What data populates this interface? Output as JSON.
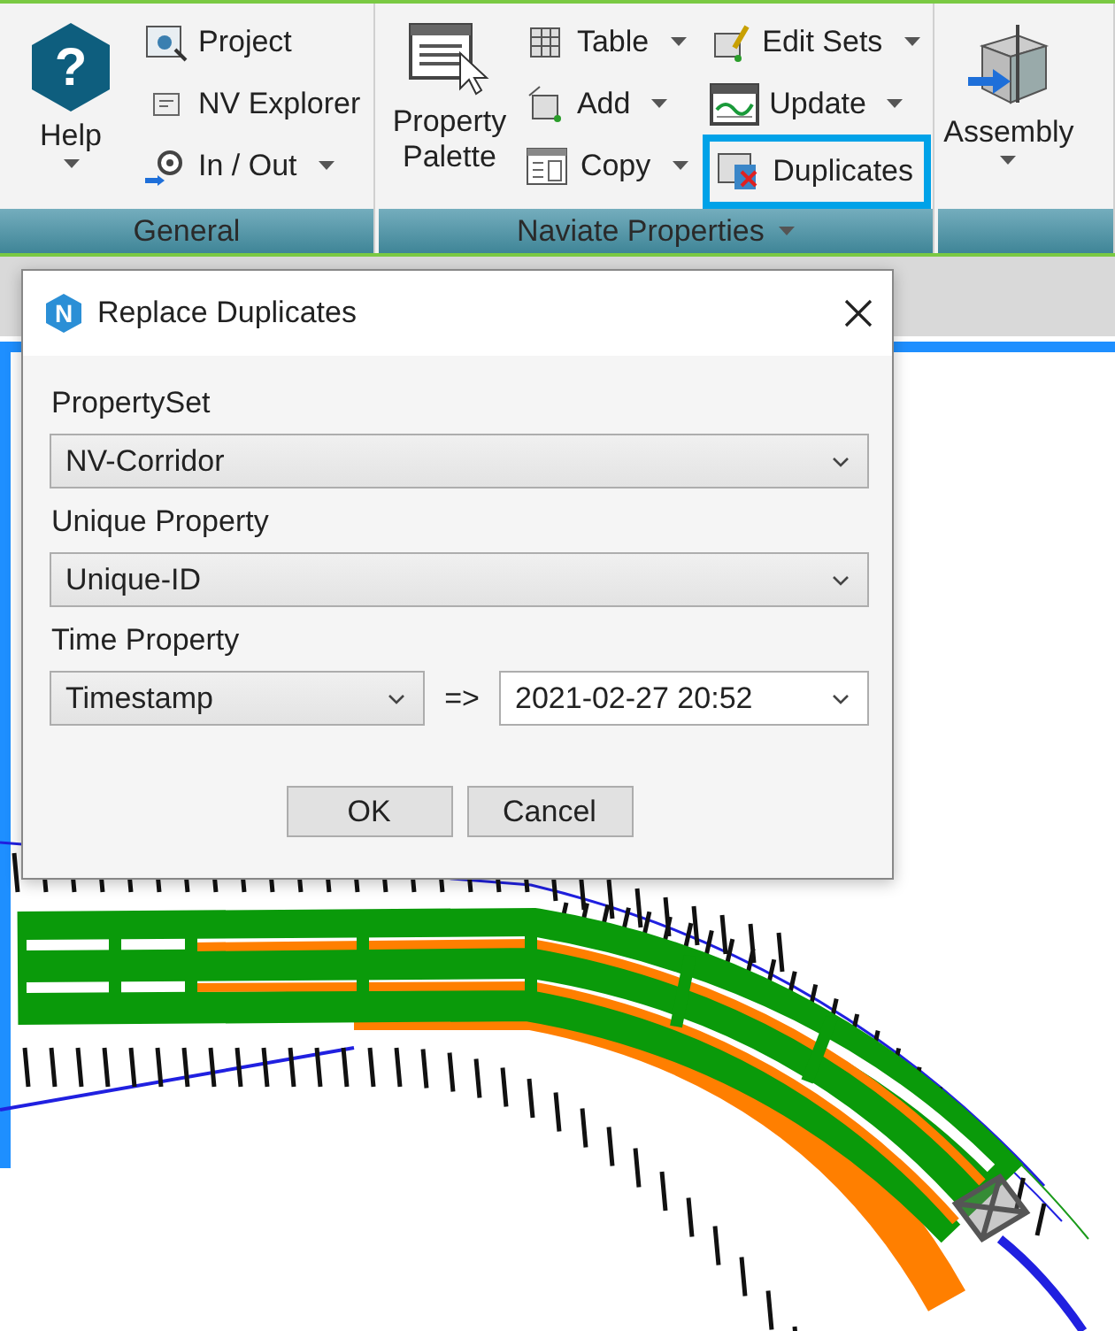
{
  "ribbon": {
    "panels": [
      {
        "title": "General",
        "has_menu": false,
        "columns": [
          [
            {
              "kind": "large",
              "label": "Help",
              "glyph": "?",
              "dropdown": true,
              "highlighted": false
            }
          ],
          [
            {
              "kind": "small",
              "label": "Project",
              "dropdown": false,
              "highlighted": false
            },
            {
              "kind": "small",
              "label": "NV Explorer",
              "dropdown": false,
              "highlighted": false
            },
            {
              "kind": "small",
              "label": "In / Out",
              "dropdown": true,
              "highlighted": false
            }
          ]
        ]
      },
      {
        "title": "Naviate Properties",
        "has_menu": true,
        "columns": [
          [
            {
              "kind": "large",
              "label": "Property Palette",
              "dropdown": false,
              "highlighted": false
            }
          ],
          [
            {
              "kind": "small",
              "label": "Table",
              "dropdown": true,
              "highlighted": false
            },
            {
              "kind": "small",
              "label": "Add",
              "dropdown": true,
              "highlighted": false
            },
            {
              "kind": "small",
              "label": "Copy",
              "dropdown": true,
              "highlighted": false
            }
          ],
          [
            {
              "kind": "small",
              "label": "Edit Sets",
              "dropdown": true,
              "highlighted": false
            },
            {
              "kind": "small",
              "label": "Update",
              "dropdown": true,
              "highlighted": false
            },
            {
              "kind": "small",
              "label": "Duplicates",
              "dropdown": false,
              "highlighted": true
            }
          ]
        ]
      },
      {
        "has_menu": false,
        "columns": [
          [
            {
              "kind": "large",
              "label": "Assembly",
              "dropdown": true,
              "highlighted": false
            }
          ]
        ]
      }
    ]
  },
  "dialog": {
    "app_icon_letter": "N",
    "title": "Replace Duplicates",
    "fields": [
      {
        "label": "PropertySet",
        "value": "NV-Corridor"
      },
      {
        "label": "Unique Property",
        "value": "Unique-ID"
      }
    ],
    "time": {
      "label": "Time Property",
      "value": "Timestamp",
      "arrow": "=>",
      "date": "2021-02-27 20:52"
    },
    "buttons": [
      "OK",
      "Cancel"
    ]
  }
}
